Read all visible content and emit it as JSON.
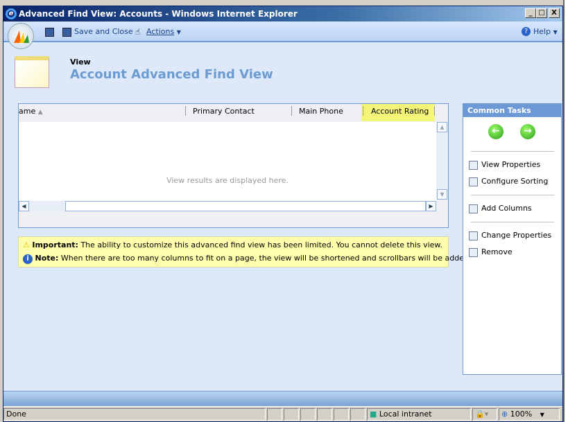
{
  "window": {
    "title": "Advanced Find View: Accounts - Windows Internet Explorer",
    "minimize": "_",
    "maximize": "□",
    "close": "X"
  },
  "toolbar": {
    "save_close": "Save and Close",
    "actions": "Actions",
    "help": "Help"
  },
  "header": {
    "label": "View",
    "name": "Account Advanced Find View"
  },
  "grid": {
    "columns": [
      "ame",
      "Primary Contact",
      "Main Phone",
      "Account Rating"
    ],
    "empty": "View results are displayed here."
  },
  "notice": {
    "important_label": "Important:",
    "important_text": " The ability to customize this advanced find view has been limited. You cannot delete this view.",
    "note_label": "Note:",
    "note_text": " When there are too many columns to fit on a page, the view will be shortened and scrollbars will be added."
  },
  "tasks": {
    "title": "Common Tasks",
    "items": [
      "View Properties",
      "Configure Sorting",
      "Add Columns",
      "Change Properties",
      "Remove"
    ]
  },
  "status": {
    "text": "Done",
    "zone": "Local intranet",
    "zoom": "100%"
  },
  "colors": {
    "accent": "#6d9ad6",
    "title_blue": "#6c9bd2",
    "highlight": "#f5f57a",
    "notice": "#ffffae"
  }
}
